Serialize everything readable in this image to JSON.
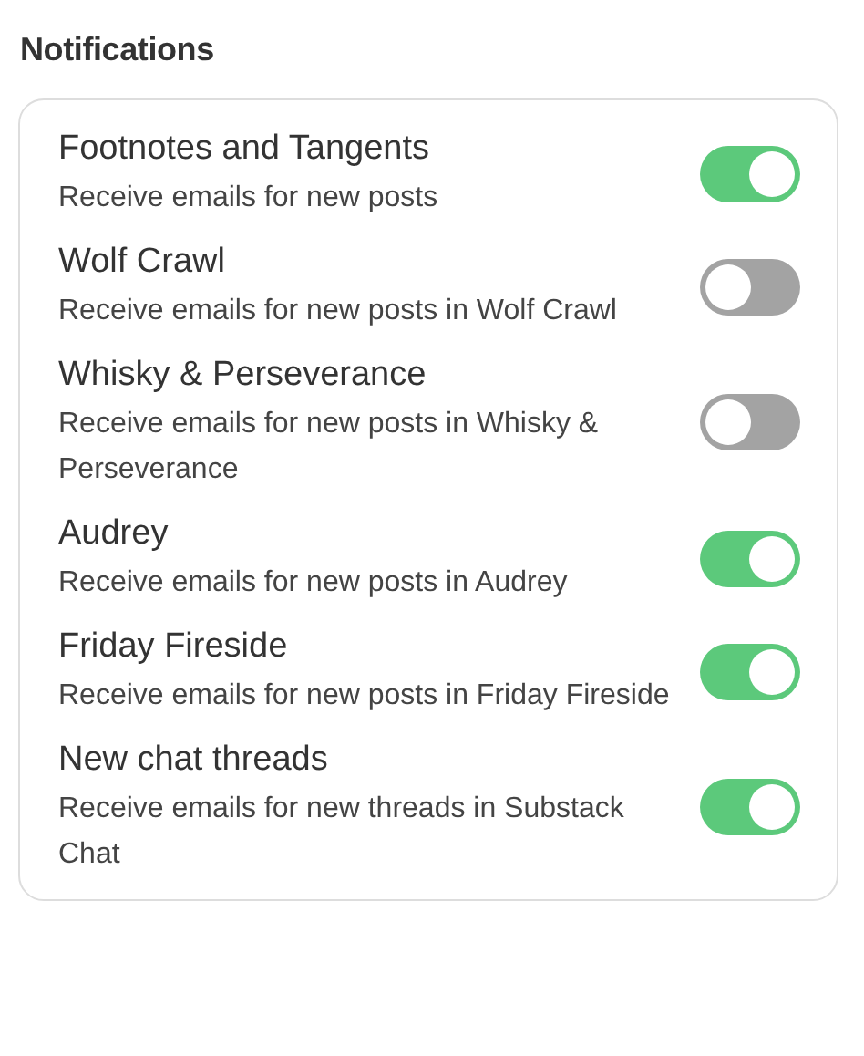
{
  "heading": "Notifications",
  "items": [
    {
      "title": "Footnotes and Tangents",
      "description": "Receive emails for new posts",
      "on": true
    },
    {
      "title": "Wolf Crawl",
      "description": "Receive emails for new posts in Wolf Crawl",
      "on": false
    },
    {
      "title": "Whisky & Perseverance",
      "description": "Receive emails for new posts in Whisky & Perseverance",
      "on": false
    },
    {
      "title": "Audrey",
      "description": "Receive emails for new posts in Audrey",
      "on": true
    },
    {
      "title": "Friday Fireside",
      "description": "Receive emails for new posts in Friday Fireside",
      "on": true
    },
    {
      "title": "New chat threads",
      "description": "Receive emails for new threads in Substack Chat",
      "on": true
    }
  ]
}
